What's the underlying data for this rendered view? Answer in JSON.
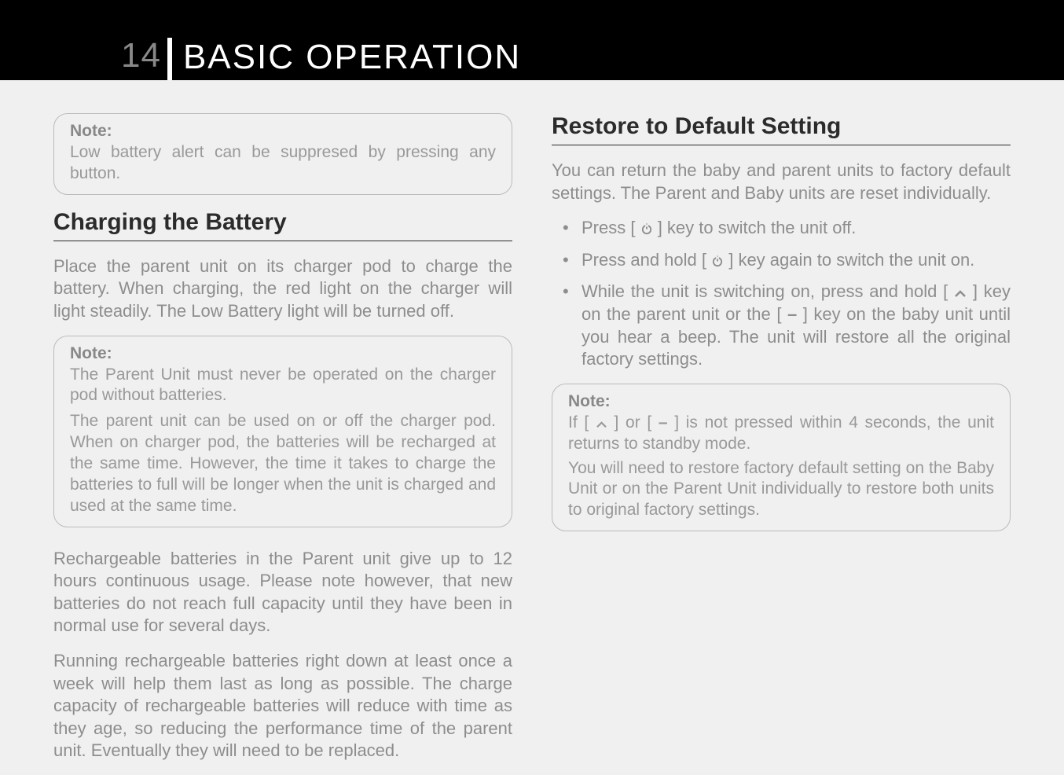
{
  "header": {
    "page_number": "14",
    "title": "BASIC OPERATION"
  },
  "left": {
    "note1": {
      "label": "Note:",
      "text": "Low battery alert can be suppresed by pressing any button."
    },
    "heading1": "Charging the Battery",
    "p1": "Place the parent unit on its charger pod to charge the battery. When charging, the red light on the charger will light steadily. The Low Battery light will be turned off.",
    "note2": {
      "label": "Note:",
      "t1": "The Parent Unit must never be operated on the charger pod without batteries.",
      "t2": "The parent unit can be used on or off the charger pod. When on charger pod, the batteries will be recharged at the same time. However, the time it takes to charge the batteries to full will be longer when the unit is charged and used at the same time."
    },
    "p2": "Rechargeable batteries in the Parent unit give up to 12 hours continuous usage. Please note however, that new batteries do not reach full capacity until they have been in normal use for several days.",
    "p3": "Running rechargeable batteries right down at least once a week will help them last as long as possible. The charge capacity of rechargeable batteries will reduce with time as they age, so reducing the performance time of the parent unit. Eventually they will need to be replaced."
  },
  "right": {
    "heading1": "Restore to Default Setting",
    "p1": "You can return the baby and parent units to factory default settings. The Parent and Baby units are reset individually.",
    "b1_pre": "Press [ ",
    "b1_post": " ] key to switch the unit off.",
    "b2_pre": "Press and hold [ ",
    "b2_post": " ] key again to switch the unit on.",
    "b3_pre": "While the unit is switching on, press and hold [ ",
    "b3_mid1": " ] key on the parent unit or the [ ",
    "b3_mid2": " ] key on the baby unit until you hear a beep. The unit will restore all the original factory settings.",
    "note3": {
      "label": "Note:",
      "t1_pre": "If [ ",
      "t1_mid1": " ] or [ ",
      "t1_post": " ] is not pressed within 4 seconds, the unit returns to standby mode.",
      "t2": "You will need to restore factory default setting on the Baby Unit or on the Parent Unit individually to restore both units to original factory settings."
    }
  },
  "icons": {
    "power": "power-icon",
    "up": "chevron-up-icon",
    "minus": "minus-icon"
  },
  "symbols": {
    "minus": "–"
  }
}
